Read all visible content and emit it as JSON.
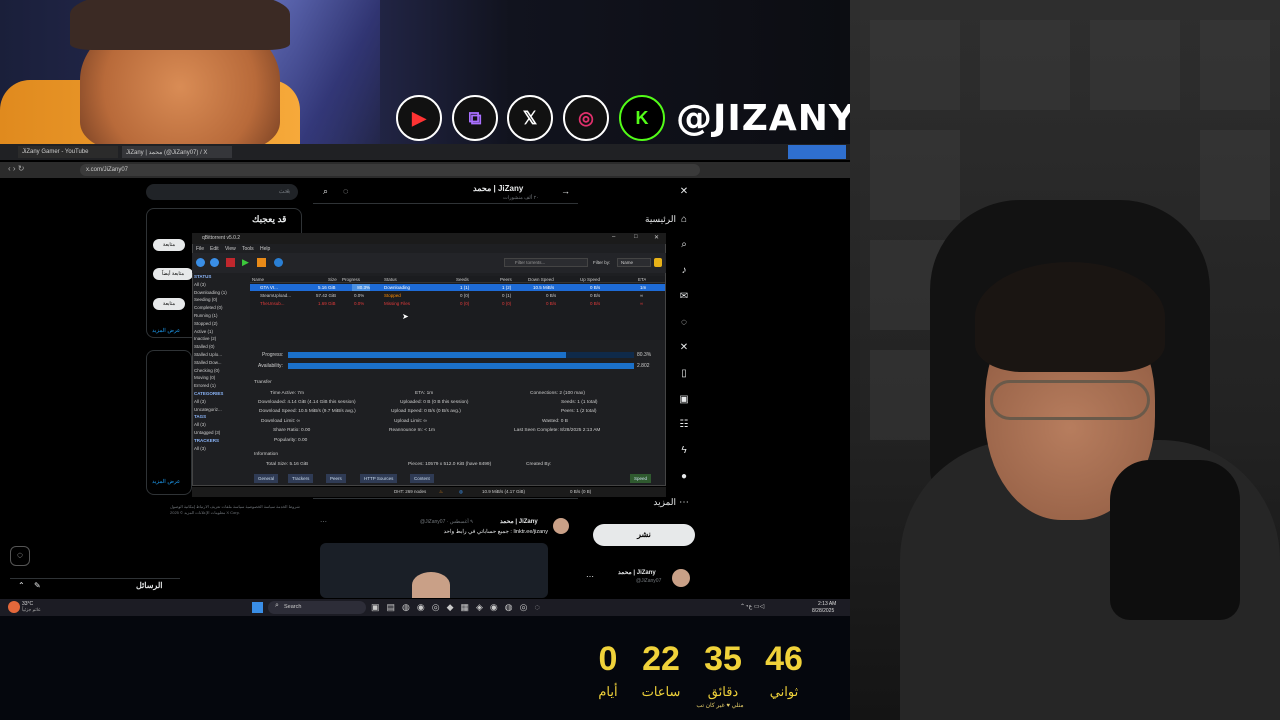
{
  "overlay": {
    "handle": "@JIZANY",
    "socials": [
      "youtube-icon",
      "twitch-icon",
      "x-icon",
      "instagram-icon",
      "kick-icon"
    ],
    "social_glyphs": [
      "▶",
      "⧉",
      "𝕏",
      "◎",
      "K"
    ]
  },
  "browser": {
    "tabs": [
      "JiZany Gamer - YouTube",
      "JiZany | محمد (@JiZany07) / X"
    ],
    "url": "x.com/JiZany07"
  },
  "xpage": {
    "search_placeholder": "بحث",
    "profile_name": "محمد | JiZany",
    "profile_posts": "٢٠ ألف منشورات",
    "who_to_follow": "قد يعجبك",
    "follow_labels": [
      "متابعة",
      "متابعة أيضاً",
      "متابعة"
    ],
    "show_more": "عرض المزيد",
    "nav": [
      "الرئيسية",
      "المزيد"
    ],
    "post_button": "نشر",
    "account_name": "محمد | JiZany",
    "account_handle": "@JiZany07",
    "tweet_author": "محمد | JiZany",
    "tweet_meta": "@JiZany07 · ٩ أغسطس",
    "tweet_text": "جميع حساباتي في رابط واحد : linktr.ee/jizany",
    "messages_label": "الرسائل",
    "footer_links": [
      "شروط الخدمة",
      "سياسة الخصوصية",
      "سياسة ملفات تعريف الارتباط",
      "إمكانية الوصول",
      "معلومات الإعلانات",
      "المزيد",
      "© 2025 X Corp."
    ]
  },
  "qbittorrent": {
    "title": "qBittorrent v5.0.2",
    "menu": [
      "File",
      "Edit",
      "View",
      "Tools",
      "Help"
    ],
    "filter_placeholder": "Filter torrents...",
    "filter_by_label": "Filter by:",
    "filter_by_value": "Name",
    "sidebar": {
      "status_header": "STATUS",
      "status_items": [
        "All (3)",
        "Downloading (1)",
        "Seeding (0)",
        "Completed (0)",
        "Running (1)",
        "Stopped (2)",
        "Active (1)",
        "Inactive (2)",
        "Stalled (0)",
        "Stalled Uplo...",
        "Stalled Dow...",
        "Checking (0)",
        "Moving (0)",
        "Errored (1)"
      ],
      "categories_header": "CATEGORIES",
      "categories_items": [
        "All (3)",
        "Uncategoriz..."
      ],
      "tags_header": "TAGS",
      "tags_items": [
        "All (3)",
        "Untagged (3)"
      ],
      "trackers_header": "TRACKERS",
      "trackers_items": [
        "All (3)"
      ]
    },
    "columns": [
      "Name",
      "Size",
      "Progress",
      "Status",
      "Seeds",
      "Peers",
      "Down Speed",
      "Up Speed",
      "ETA"
    ],
    "rows": [
      {
        "name": "GTA VI...",
        "size": "5.16 GiB",
        "progress": "80.3%",
        "status": "Downloading",
        "seeds": "1 (1)",
        "peers": "1 (2)",
        "down": "10.5 MiB/s",
        "up": "0 B/s",
        "eta": "1m"
      },
      {
        "name": "SteamUpload...",
        "size": "57.42 GiB",
        "progress": "0.0%",
        "status": "Stopped",
        "seeds": "0 (0)",
        "peers": "0 (1)",
        "down": "0 B/s",
        "up": "0 B/s",
        "eta": "∞"
      },
      {
        "name": "TheUnsub...",
        "size": "1.69 GiB",
        "progress": "0.0%",
        "status": "Missing Files",
        "seeds": "0 (0)",
        "peers": "0 (0)",
        "down": "0 B/s",
        "up": "0 B/s",
        "eta": "∞"
      }
    ],
    "progress_label": "Progress:",
    "progress_value": "80.3%",
    "progress_fraction": 0.803,
    "availability_label": "Availability:",
    "availability_value": "2.802",
    "transfer_header": "Transfer",
    "transfer": {
      "time_active": "Time Active: 7m",
      "downloaded": "Downloaded: 4.14 GiB (4.14 GiB this session)",
      "download_speed": "Download Speed: 10.5 MiB/s (9.7 MiB/s avg.)",
      "download_limit": "Download Limit: ∞",
      "share_ratio": "Share Ratio: 0.00",
      "popularity": "Popularity: 0.00",
      "eta": "ETA: 1m",
      "uploaded": "Uploaded: 0 B (0 B this session)",
      "upload_speed": "Upload Speed: 0 B/s (0 B/s avg.)",
      "upload_limit": "Upload Limit: ∞",
      "reannounce": "Reannounce In: < 1m",
      "connections": "Connections: 2 (100 max)",
      "seeds": "Seeds: 1 (1 total)",
      "peers": "Peers: 1 (2 total)",
      "wasted": "Wasted: 0 B",
      "last_seen": "Last Seen Complete: 8/28/2025 2:13 AM"
    },
    "information_header": "Information",
    "info": {
      "total_size": "Total Size: 5.16 GiB",
      "pieces": "Pieces: 10579 x 512.0 KiB (have 8499)",
      "created_by": "Created By:"
    },
    "bottom_tabs": [
      "General",
      "Trackers",
      "Peers",
      "HTTP Sources",
      "Content"
    ],
    "speed_tab": "Speed",
    "status_bar": {
      "dht": "DHT: 269 nodes",
      "down": "10.9 MiB/s (4.17 GiB)",
      "up": "0 B/s (0 B)"
    }
  },
  "taskbar": {
    "weather": "33°C",
    "weather_sub": "غائم جزئياً",
    "search": "Search",
    "time": "2:13 AM",
    "date": "8/28/2025"
  },
  "countdown": {
    "values": [
      "46",
      "35",
      "22",
      "0"
    ],
    "labels": [
      "ثواني",
      "دقائق",
      "ساعات",
      "أيام"
    ],
    "footer": "مثلي ♥ غير كان تب"
  }
}
